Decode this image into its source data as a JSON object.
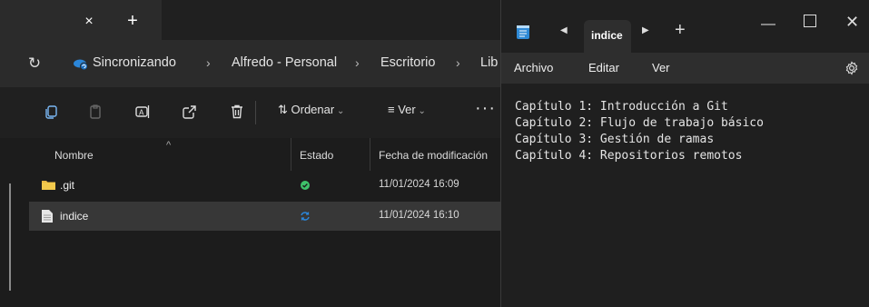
{
  "explorer": {
    "tab": {
      "close_glyph": "×",
      "new_glyph": "+"
    },
    "address": {
      "status": "Sincronizando",
      "crumbs": [
        "Alfredo - Personal",
        "Escritorio",
        "Lib"
      ],
      "separator": "›"
    },
    "toolbar": {
      "sort_label": "Ordenar",
      "view_label": "Ver",
      "more_glyph": "···"
    },
    "columns": {
      "name": "Nombre",
      "status": "Estado",
      "modified": "Fecha de modificación"
    },
    "files": [
      {
        "name": ".git",
        "type": "folder",
        "status": "synced",
        "date": "11/01/2024 16:09"
      },
      {
        "name": "indice",
        "type": "file",
        "status": "syncing",
        "date": "11/01/2024 16:10"
      }
    ]
  },
  "notepad": {
    "tab_title": "indice",
    "menus": [
      "Archivo",
      "Editar",
      "Ver"
    ],
    "content_lines": [
      "Capítulo 1: Introducción a Git",
      "Capítulo 2: Flujo de trabajo básico",
      "Capítulo 3: Gestión de ramas",
      "Capítulo 4: Repositorios remotos"
    ]
  },
  "colors": {
    "accent": "#2b86d9",
    "synced": "#3ec26a",
    "folder": "#e8b845"
  }
}
